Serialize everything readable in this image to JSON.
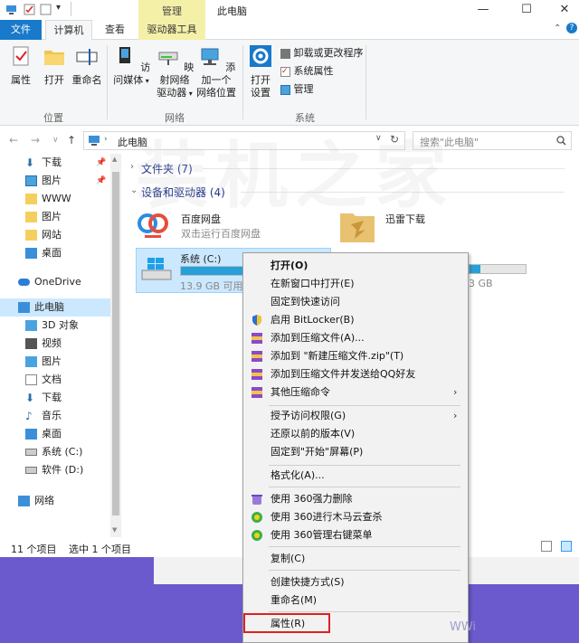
{
  "titlebar": {
    "context_tab": "管理",
    "title": "此电脑",
    "minimize": "—",
    "maximize": "☐",
    "close": "✕"
  },
  "tabs": {
    "file": "文件",
    "computer": "计算机",
    "view": "查看",
    "drive_tools": "驱动器工具"
  },
  "ribbon": {
    "location": {
      "properties": "属性",
      "open": "打开",
      "rename": "重命名",
      "group": "位置"
    },
    "network": {
      "access_media": "访问媒体",
      "map_drive_1": "映射网络",
      "map_drive_2": "驱动器",
      "add_location_1": "添加一个",
      "add_location_2": "网络位置",
      "group": "网络"
    },
    "system": {
      "open_settings_1": "打开",
      "open_settings_2": "设置",
      "uninstall": "卸载或更改程序",
      "sys_props": "系统属性",
      "manage": "管理",
      "group": "系统"
    }
  },
  "address": {
    "path": "此电脑",
    "search_placeholder": "搜索\"此电脑\""
  },
  "sidebar": {
    "items": [
      {
        "label": "下载",
        "pinned": true
      },
      {
        "label": "图片",
        "pinned": true
      },
      {
        "label": "WWW"
      },
      {
        "label": "图片"
      },
      {
        "label": "网站"
      },
      {
        "label": "桌面"
      },
      {
        "label": "OneDrive"
      },
      {
        "label": "此电脑"
      },
      {
        "label": "3D 对象"
      },
      {
        "label": "视频"
      },
      {
        "label": "图片"
      },
      {
        "label": "文档"
      },
      {
        "label": "下载"
      },
      {
        "label": "音乐"
      },
      {
        "label": "桌面"
      },
      {
        "label": "系统 (C:)"
      },
      {
        "label": "软件 (D:)"
      },
      {
        "label": "网络"
      }
    ]
  },
  "content": {
    "folders_header": "文件夹 (7)",
    "devices_header": "设备和驱动器 (4)",
    "drives": [
      {
        "name": "百度网盘",
        "sub": "双击运行百度网盘"
      },
      {
        "name": "迅雷下载",
        "sub": ""
      },
      {
        "name": "系统 (C:)",
        "sub": "13.9 GB 可用,",
        "usage": 0.85
      },
      {
        "name": "",
        "sub": "3 GB",
        "usage": 0.2
      }
    ]
  },
  "status": {
    "count": "11 个项目",
    "selected": "选中 1 个项目"
  },
  "context_menu": {
    "items": [
      "打开(O)",
      "在新窗口中打开(E)",
      "固定到快速访问",
      "启用 BitLocker(B)",
      "添加到压缩文件(A)...",
      "添加到 \"新建压缩文件.zip\"(T)",
      "添加到压缩文件并发送给QQ好友",
      "其他压缩命令",
      "授予访问权限(G)",
      "还原以前的版本(V)",
      "固定到\"开始\"屏幕(P)",
      "格式化(A)...",
      "使用 360强力删除",
      "使用 360进行木马云查杀",
      "使用 360管理右键菜单",
      "复制(C)",
      "创建快捷方式(S)",
      "重命名(M)",
      "属性(R)"
    ]
  },
  "watermark": {
    "main": "装机之家",
    "corner": "WWi"
  },
  "colors": {
    "accent": "#1979ca",
    "manage_tab": "#f5f0a8",
    "highlight": "#e02020",
    "desktop": "#6a5acd"
  }
}
